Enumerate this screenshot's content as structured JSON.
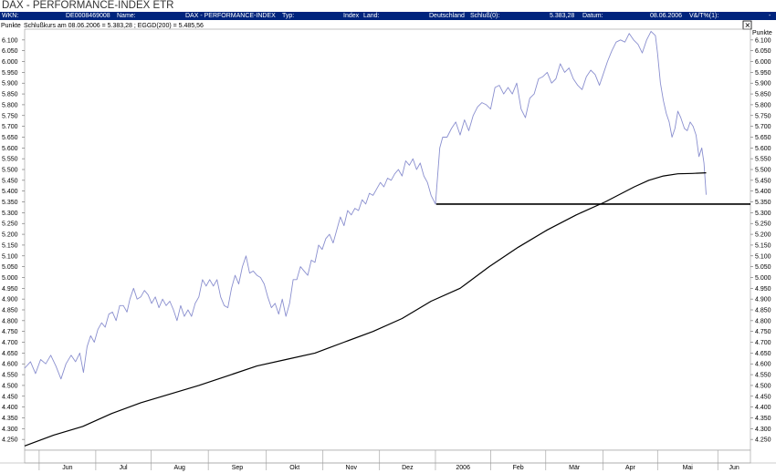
{
  "title": "DAX - PERFORMANCE-INDEX ETR",
  "info": {
    "wkn_label": "WKN:",
    "wkn_value": "DE0008469008",
    "name_label": "Name:",
    "name_value": "DAX - PERFORMANCE-INDEX",
    "typ_label": "Typ:",
    "typ_value": "Index",
    "land_label": "Land:",
    "land_value": "Deutschland",
    "schluss_label": "Schluß(0):",
    "schluss_value": "5.383,28",
    "datum_label": "Datum:",
    "datum_value": "08.06.2006",
    "change_label": "V&/T%(1):",
    "change_value": "-"
  },
  "close_glyph": "✕",
  "legend": "Schlußkurs am 08.06.2006 = 5.383,28 ; EGGD(200) = 5.485,56",
  "ylabel": "Punkte",
  "colors": {
    "header": "#00247d",
    "price": "#8a8fcf",
    "avg": "#000000",
    "grid": "#bbbbbb"
  },
  "chart_data": {
    "type": "line",
    "ylabel": "Punkte",
    "ylim": [
      4200,
      6150
    ],
    "yticks": [
      4250,
      4300,
      4350,
      4400,
      4450,
      4500,
      4550,
      4600,
      4650,
      4700,
      4750,
      4800,
      4850,
      4900,
      4950,
      5000,
      5050,
      5100,
      5150,
      5200,
      5250,
      5300,
      5350,
      5400,
      5450,
      5500,
      5550,
      5600,
      5650,
      5700,
      5750,
      5800,
      5850,
      5900,
      5950,
      6000,
      6050,
      6100
    ],
    "xlim": [
      0,
      100
    ],
    "months": [
      {
        "label": "Jun",
        "x": 2.0
      },
      {
        "label": "Jul",
        "x": 9.8
      },
      {
        "label": "Aug",
        "x": 17.4
      },
      {
        "label": "Sep",
        "x": 25.3
      },
      {
        "label": "Okt",
        "x": 33.3
      },
      {
        "label": "Nov",
        "x": 41.1
      },
      {
        "label": "Dez",
        "x": 48.9
      },
      {
        "label": "2006",
        "x": 56.6
      },
      {
        "label": "Feb",
        "x": 64.2
      },
      {
        "label": "Mär",
        "x": 71.8
      },
      {
        "label": "Apr",
        "x": 79.7
      },
      {
        "label": "Mai",
        "x": 87.2
      },
      {
        "label": "Jun",
        "x": 95.5
      }
    ],
    "support_level": 5340,
    "support_range": [
      56.7,
      100
    ],
    "series": [
      {
        "name": "Schlußkurs",
        "color": "#8a8fcf",
        "points": [
          [
            0.0,
            4580
          ],
          [
            0.8,
            4610
          ],
          [
            1.5,
            4555
          ],
          [
            2.2,
            4620
          ],
          [
            2.9,
            4600
          ],
          [
            3.6,
            4640
          ],
          [
            4.3,
            4590
          ],
          [
            5.0,
            4530
          ],
          [
            5.7,
            4600
          ],
          [
            6.4,
            4640
          ],
          [
            7.0,
            4610
          ],
          [
            7.6,
            4650
          ],
          [
            8.1,
            4560
          ],
          [
            8.6,
            4680
          ],
          [
            9.1,
            4730
          ],
          [
            9.6,
            4700
          ],
          [
            10.1,
            4760
          ],
          [
            10.6,
            4790
          ],
          [
            11.1,
            4770
          ],
          [
            11.6,
            4830
          ],
          [
            12.1,
            4840
          ],
          [
            12.6,
            4800
          ],
          [
            13.1,
            4870
          ],
          [
            13.6,
            4870
          ],
          [
            14.1,
            4840
          ],
          [
            14.5,
            4900
          ],
          [
            15.0,
            4950
          ],
          [
            15.5,
            4900
          ],
          [
            16.0,
            4910
          ],
          [
            16.5,
            4940
          ],
          [
            17.0,
            4920
          ],
          [
            17.5,
            4880
          ],
          [
            18.0,
            4910
          ],
          [
            18.5,
            4860
          ],
          [
            19.0,
            4900
          ],
          [
            19.5,
            4870
          ],
          [
            20.0,
            4890
          ],
          [
            20.5,
            4850
          ],
          [
            21.0,
            4800
          ],
          [
            21.5,
            4870
          ],
          [
            22.0,
            4820
          ],
          [
            22.5,
            4850
          ],
          [
            23.0,
            4820
          ],
          [
            23.5,
            4880
          ],
          [
            24.0,
            4910
          ],
          [
            24.5,
            4990
          ],
          [
            25.0,
            4960
          ],
          [
            25.5,
            4990
          ],
          [
            26.0,
            4960
          ],
          [
            26.5,
            4990
          ],
          [
            27.0,
            4910
          ],
          [
            27.5,
            4870
          ],
          [
            28.0,
            4860
          ],
          [
            28.5,
            4950
          ],
          [
            29.0,
            5010
          ],
          [
            29.5,
            4970
          ],
          [
            30.0,
            5050
          ],
          [
            30.5,
            5100
          ],
          [
            31.0,
            5020
          ],
          [
            31.5,
            5030
          ],
          [
            32.0,
            5010
          ],
          [
            32.5,
            5000
          ],
          [
            33.0,
            4970
          ],
          [
            33.5,
            4910
          ],
          [
            34.0,
            4860
          ],
          [
            34.5,
            4880
          ],
          [
            35.0,
            4830
          ],
          [
            35.5,
            4900
          ],
          [
            36.0,
            4820
          ],
          [
            36.5,
            4880
          ],
          [
            37.0,
            4990
          ],
          [
            37.5,
            4990
          ],
          [
            38.0,
            5050
          ],
          [
            38.5,
            5030
          ],
          [
            39.0,
            5010
          ],
          [
            39.5,
            5080
          ],
          [
            40.0,
            5070
          ],
          [
            40.5,
            5150
          ],
          [
            41.0,
            5130
          ],
          [
            41.5,
            5180
          ],
          [
            42.0,
            5200
          ],
          [
            42.5,
            5160
          ],
          [
            43.0,
            5220
          ],
          [
            43.5,
            5280
          ],
          [
            44.0,
            5240
          ],
          [
            44.5,
            5310
          ],
          [
            45.0,
            5290
          ],
          [
            45.5,
            5320
          ],
          [
            46.0,
            5310
          ],
          [
            46.5,
            5360
          ],
          [
            47.0,
            5340
          ],
          [
            47.5,
            5390
          ],
          [
            48.0,
            5380
          ],
          [
            48.5,
            5410
          ],
          [
            49.0,
            5440
          ],
          [
            49.5,
            5420
          ],
          [
            50.0,
            5460
          ],
          [
            50.5,
            5450
          ],
          [
            51.0,
            5480
          ],
          [
            51.5,
            5500
          ],
          [
            52.0,
            5470
          ],
          [
            52.5,
            5540
          ],
          [
            53.0,
            5520
          ],
          [
            53.5,
            5550
          ],
          [
            54.0,
            5500
          ],
          [
            54.5,
            5530
          ],
          [
            55.0,
            5470
          ],
          [
            55.5,
            5440
          ],
          [
            56.0,
            5380
          ],
          [
            56.6,
            5340
          ],
          [
            57.2,
            5600
          ],
          [
            57.6,
            5650
          ],
          [
            58.2,
            5650
          ],
          [
            58.8,
            5690
          ],
          [
            59.4,
            5720
          ],
          [
            60.0,
            5660
          ],
          [
            60.6,
            5730
          ],
          [
            61.2,
            5680
          ],
          [
            61.8,
            5750
          ],
          [
            62.4,
            5790
          ],
          [
            63.0,
            5810
          ],
          [
            63.6,
            5800
          ],
          [
            64.2,
            5780
          ],
          [
            64.8,
            5880
          ],
          [
            65.4,
            5890
          ],
          [
            66.0,
            5850
          ],
          [
            66.6,
            5880
          ],
          [
            67.2,
            5850
          ],
          [
            67.8,
            5900
          ],
          [
            68.4,
            5780
          ],
          [
            69.0,
            5740
          ],
          [
            69.6,
            5830
          ],
          [
            70.2,
            5850
          ],
          [
            70.8,
            5920
          ],
          [
            71.4,
            5930
          ],
          [
            72.0,
            5950
          ],
          [
            72.6,
            5900
          ],
          [
            73.2,
            5920
          ],
          [
            73.8,
            5990
          ],
          [
            74.4,
            5950
          ],
          [
            75.0,
            5970
          ],
          [
            75.6,
            5920
          ],
          [
            76.2,
            5890
          ],
          [
            76.8,
            5870
          ],
          [
            77.4,
            5930
          ],
          [
            78.0,
            5960
          ],
          [
            78.6,
            5940
          ],
          [
            79.2,
            5890
          ],
          [
            79.7,
            5940
          ],
          [
            80.3,
            6000
          ],
          [
            80.9,
            6050
          ],
          [
            81.5,
            6090
          ],
          [
            82.1,
            6100
          ],
          [
            82.7,
            6090
          ],
          [
            83.3,
            6130
          ],
          [
            83.9,
            6100
          ],
          [
            84.5,
            6080
          ],
          [
            85.1,
            6040
          ],
          [
            85.7,
            6100
          ],
          [
            86.3,
            6140
          ],
          [
            86.9,
            6120
          ],
          [
            87.2,
            6040
          ],
          [
            87.6,
            5900
          ],
          [
            88.0,
            5820
          ],
          [
            88.4,
            5760
          ],
          [
            88.8,
            5720
          ],
          [
            89.2,
            5650
          ],
          [
            89.6,
            5690
          ],
          [
            90.0,
            5770
          ],
          [
            90.4,
            5740
          ],
          [
            90.9,
            5690
          ],
          [
            91.3,
            5680
          ],
          [
            91.7,
            5720
          ],
          [
            92.1,
            5700
          ],
          [
            92.5,
            5660
          ],
          [
            92.9,
            5560
          ],
          [
            93.3,
            5600
          ],
          [
            93.6,
            5530
          ],
          [
            93.9,
            5383
          ]
        ]
      },
      {
        "name": "EGGD(200)",
        "color": "#000000",
        "points": [
          [
            0.0,
            4220
          ],
          [
            4.0,
            4270
          ],
          [
            8.0,
            4310
          ],
          [
            12.0,
            4370
          ],
          [
            16.0,
            4420
          ],
          [
            20.0,
            4460
          ],
          [
            24.0,
            4500
          ],
          [
            28.0,
            4545
          ],
          [
            32.0,
            4590
          ],
          [
            36.0,
            4620
          ],
          [
            40.0,
            4650
          ],
          [
            44.0,
            4700
          ],
          [
            48.0,
            4750
          ],
          [
            52.0,
            4810
          ],
          [
            56.0,
            4890
          ],
          [
            60.0,
            4950
          ],
          [
            64.0,
            5050
          ],
          [
            68.0,
            5140
          ],
          [
            72.0,
            5220
          ],
          [
            76.0,
            5290
          ],
          [
            80.0,
            5350
          ],
          [
            84.0,
            5420
          ],
          [
            86.0,
            5450
          ],
          [
            88.0,
            5470
          ],
          [
            90.0,
            5480
          ],
          [
            92.0,
            5482
          ],
          [
            93.9,
            5485
          ]
        ]
      }
    ]
  }
}
